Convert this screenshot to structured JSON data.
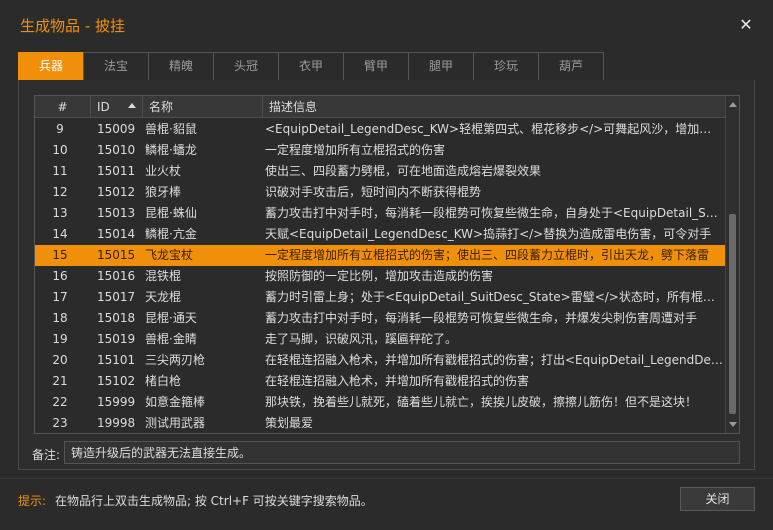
{
  "dialog": {
    "title": "生成物品 - 披挂",
    "close_glyph": "✕"
  },
  "tabs": [
    {
      "label": "兵器",
      "active": true
    },
    {
      "label": "法宝",
      "active": false
    },
    {
      "label": "精魄",
      "active": false
    },
    {
      "label": "头冠",
      "active": false
    },
    {
      "label": "衣甲",
      "active": false
    },
    {
      "label": "臂甲",
      "active": false
    },
    {
      "label": "腿甲",
      "active": false
    },
    {
      "label": "珍玩",
      "active": false
    },
    {
      "label": "葫芦",
      "active": false
    }
  ],
  "table": {
    "columns": {
      "no": "#",
      "id": "ID",
      "name": "名称",
      "desc": "描述信息"
    },
    "sort": {
      "column": "id",
      "direction": "asc"
    },
    "selected_row": "15",
    "rows": [
      {
        "no": "9",
        "id": "15009",
        "name": "兽棍·貂鼠",
        "desc": "<EquipDetail_LegendDesc_KW>轻棍第四式、棍花移步</>可舞起风沙，增加攻击"
      },
      {
        "no": "10",
        "id": "15010",
        "name": "鳞棍·蟠龙",
        "desc": "一定程度增加所有立棍招式的伤害"
      },
      {
        "no": "11",
        "id": "15011",
        "name": "业火杖",
        "desc": "使出三、四段蓄力劈棍，可在地面造成熔岩爆裂效果"
      },
      {
        "no": "12",
        "id": "15012",
        "name": "狼牙棒",
        "desc": "识破对手攻击后，短时间内不断获得棍势"
      },
      {
        "no": "13",
        "id": "15013",
        "name": "昆棍·蛛仙",
        "desc": "蓄力攻击打中对手时，每消耗一段棍势可恢复些微生命，自身处于<EquipDetail_SuitDesc_State>"
      },
      {
        "no": "14",
        "id": "15014",
        "name": "鳞棍·亢金",
        "desc": "天赋<EquipDetail_LegendDesc_KW>捣蒜打</>替换为造成雷电伤害，可令对手"
      },
      {
        "no": "15",
        "id": "15015",
        "name": "飞龙宝杖",
        "desc": "一定程度增加所有立棍招式的伤害；使出三、四段蓄力立棍时，引出天龙，劈下落雷"
      },
      {
        "no": "16",
        "id": "15016",
        "name": "混铁棍",
        "desc": "按照防御的一定比例，增加攻击造成的伤害"
      },
      {
        "no": "17",
        "id": "15017",
        "name": "天龙棍",
        "desc": "蓄力时引雷上身；处于<EquipDetail_SuitDesc_State>雷璧</>状态时，所有棍法附带"
      },
      {
        "no": "18",
        "id": "15018",
        "name": "昆棍·通天",
        "desc": "蓄力攻击打中对手时，每消耗一段棍势可恢复些微生命，并爆发尖刺伤害周遭对手"
      },
      {
        "no": "19",
        "id": "15019",
        "name": "兽棍·金睛",
        "desc": "走了马脚，识破风汛，蹊匾秤砣了。"
      },
      {
        "no": "20",
        "id": "15101",
        "name": "三尖两刃枪",
        "desc": "在轻棍连招融入枪术，并增加所有戳棍招式的伤害；打出<EquipDetail_LegendDesc_KW>"
      },
      {
        "no": "21",
        "id": "15102",
        "name": "楮白枪",
        "desc": "在轻棍连招融入枪术，并增加所有戳棍招式的伤害"
      },
      {
        "no": "22",
        "id": "15999",
        "name": "如意金箍棒",
        "desc": "那块铁，挽着些儿就死，磕着些儿就亡，挨挨儿皮破，擦擦儿筋伤！但不是这块！"
      },
      {
        "no": "23",
        "id": "19998",
        "name": "测试用武器",
        "desc": "策划最爱"
      }
    ]
  },
  "note": {
    "label": "备注:",
    "value": "铸造升级后的武器无法直接生成。"
  },
  "footer": {
    "hint_label": "提示:",
    "hint_text": "在物品行上双击生成物品; 按 Ctrl+F 可按关键字搜索物品。",
    "close_label": "关闭"
  },
  "colors": {
    "accent": "#f0900a",
    "background": "#2b2b2b",
    "text": "#dcdcdc"
  }
}
